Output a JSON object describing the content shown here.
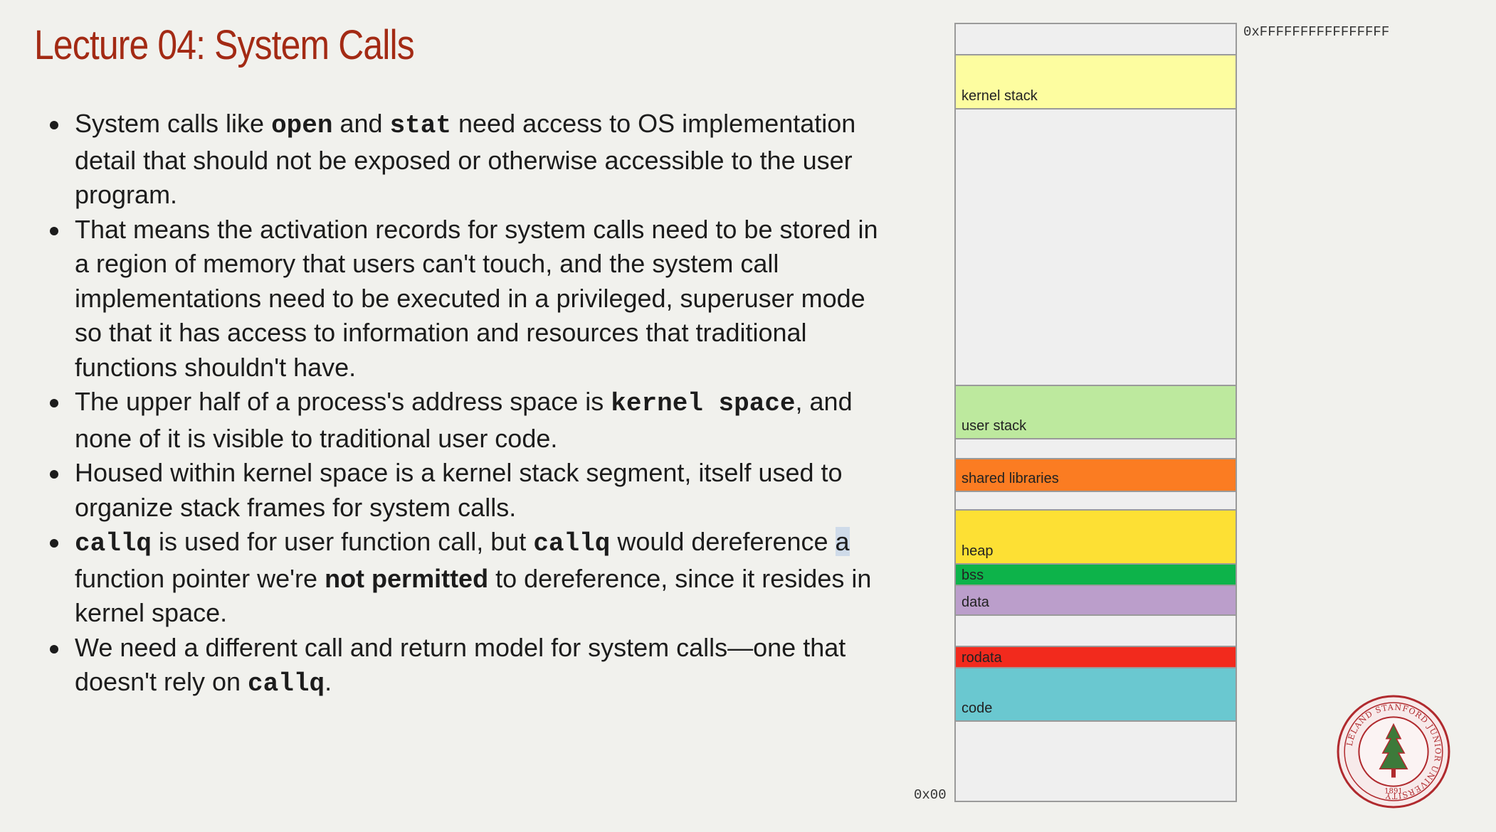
{
  "slide": {
    "title": "Lecture 04: System Calls"
  },
  "bullets": {
    "b1": {
      "t1": "System calls like ",
      "c1": "open",
      "t2": " and ",
      "c2": "stat",
      "t3": " need access to OS implementation detail that should not be exposed or otherwise accessible to the user program."
    },
    "b2": {
      "t1": "That means the activation records for system calls need to be stored in a region of memory that users can't touch, and the system call implementations need to be executed in a privileged, superuser mode so that it has access to information and resources that traditional functions shouldn't have."
    },
    "b3": {
      "t1": "The upper half of a process's address space is ",
      "c1": "kernel space",
      "t2": ", and none of it is visible to traditional user code."
    },
    "b4": {
      "t1": "Housed within kernel space is a kernel stack segment, itself used to organize stack frames for system calls."
    },
    "b5": {
      "c1": "callq",
      "t1": " is used for user function call, but ",
      "c2": "callq",
      "t2": " would dereference ",
      "hl": "a",
      "t3": " function pointer we're ",
      "bold": "not permitted",
      "t4": " to dereference, since it resides in kernel space."
    },
    "b6": {
      "t1": "We need a different call and return model for system calls—one that doesn't rely on ",
      "c1": "callq",
      "t2": "."
    }
  },
  "memory": {
    "top_address": "0xFFFFFFFFFFFFFFFF",
    "bottom_address": "0x00",
    "segments": {
      "kernel_stack": {
        "label": "kernel stack",
        "color": "#fdfda0"
      },
      "user_stack": {
        "label": "user stack",
        "color": "#bde99e"
      },
      "shared_libraries": {
        "label": "shared libraries",
        "color": "#fb7c22"
      },
      "heap": {
        "label": "heap",
        "color": "#fde034"
      },
      "bss": {
        "label": "bss",
        "color": "#0db34a"
      },
      "data": {
        "label": "data",
        "color": "#bb9ecb"
      },
      "rodata": {
        "label": "rodata",
        "color": "#f22a1d"
      },
      "code": {
        "label": "code",
        "color": "#6ac8d0"
      }
    }
  },
  "logo": {
    "name": "stanford-university-seal",
    "year": "1891",
    "text": "LELAND STANFORD JUNIOR UNIVERSITY"
  }
}
